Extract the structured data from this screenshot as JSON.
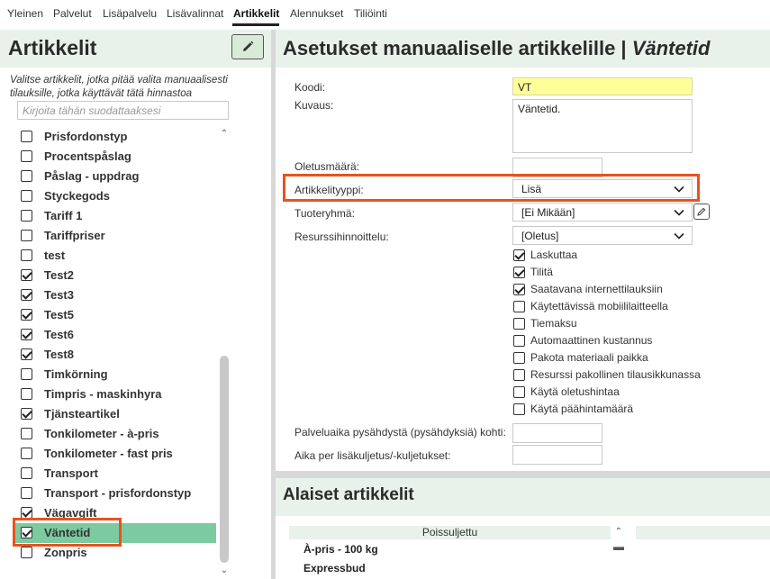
{
  "top_tabs": [
    {
      "label": "Yleinen",
      "active": false
    },
    {
      "label": "Palvelut",
      "active": false
    },
    {
      "label": "Lisäpalvelu",
      "active": false
    },
    {
      "label": "Lisävalinnat",
      "active": false
    },
    {
      "label": "Artikkelit",
      "active": true
    },
    {
      "label": "Alennukset",
      "active": false
    },
    {
      "label": "Tiliöinti",
      "active": false
    }
  ],
  "left": {
    "title": "Artikkelit",
    "hint": "Valitse artikkelit, jotka pitää valita manuaalisesti tilauksille, jotka käyttävät tätä hinnastoa",
    "filter_placeholder": "Kirjoita tähän suodattaaksesi",
    "items": [
      {
        "label": "Prisfordonstyp",
        "checked": false
      },
      {
        "label": "Procentspåslag",
        "checked": false
      },
      {
        "label": "Påslag - uppdrag",
        "checked": false
      },
      {
        "label": "Styckegods",
        "checked": false
      },
      {
        "label": "Tariff 1",
        "checked": false
      },
      {
        "label": "Tariffpriser",
        "checked": false
      },
      {
        "label": "test",
        "checked": false
      },
      {
        "label": "Test2",
        "checked": true
      },
      {
        "label": "Test3",
        "checked": true
      },
      {
        "label": "Test5",
        "checked": true
      },
      {
        "label": "Test6",
        "checked": true
      },
      {
        "label": "Test8",
        "checked": true
      },
      {
        "label": "Timkörning",
        "checked": false
      },
      {
        "label": "Timpris - maskinhyra",
        "checked": false
      },
      {
        "label": "Tjänsteartikel",
        "checked": true
      },
      {
        "label": "Tonkilometer - à-pris",
        "checked": false
      },
      {
        "label": "Tonkilometer - fast pris",
        "checked": false
      },
      {
        "label": "Transport",
        "checked": false
      },
      {
        "label": "Transport - prisfordonstyp",
        "checked": false
      },
      {
        "label": "Vägavgift",
        "checked": true
      },
      {
        "label": "Väntetid",
        "checked": true,
        "selected": true
      },
      {
        "label": "Zonpris",
        "checked": false
      }
    ]
  },
  "right": {
    "title_prefix": "Asetukset manuaaliselle artikkelille | ",
    "title_item": "Väntetid",
    "fields": {
      "koodi_label": "Koodi:",
      "koodi_value": "VT",
      "kuvaus_label": "Kuvaus:",
      "kuvaus_value": "Väntetid.",
      "oletusmaara_label": "Oletusmäärä:",
      "oletusmaara_value": "",
      "artikkelityyppi_label": "Artikkelityyppi:",
      "artikkelityyppi_value": "Lisä",
      "tuoteryhma_label": "Tuoteryhmä:",
      "tuoteryhma_value": "[Ei Mikään]",
      "resurssi_label": "Resurssihinnoittelu:",
      "resurssi_value": "[Oletus]",
      "palveluaika_label": "Palveluaika pysähdystä (pysähdyksiä) kohti:",
      "aika_label": "Aika per lisäkuljetus/-kuljetukset:"
    },
    "options": [
      {
        "label": "Laskuttaa",
        "checked": true
      },
      {
        "label": "Tilitä",
        "checked": true
      },
      {
        "label": "Saatavana internettilauksiin",
        "checked": true
      },
      {
        "label": "Käytettävissä mobiililaitteella",
        "checked": false
      },
      {
        "label": "Tiemaksu",
        "checked": false
      },
      {
        "label": "Automaattinen kustannus",
        "checked": false
      },
      {
        "label": "Pakota materiaali paikka",
        "checked": false
      },
      {
        "label": "Resurssi pakollinen tilausikkunassa",
        "checked": false
      },
      {
        "label": "Käytä oletushintaa",
        "checked": false
      },
      {
        "label": "Käytä päähintamäärä",
        "checked": false
      }
    ],
    "sub_title": "Alaiset artikkelit",
    "sub_column": "Poissuljettu",
    "sub_rows": [
      "À-pris - 100 kg",
      "Expressbud"
    ]
  },
  "colors": {
    "accent": "#e8531e",
    "selected": "#7ccaa0",
    "header_bg": "#e8f2ea"
  }
}
